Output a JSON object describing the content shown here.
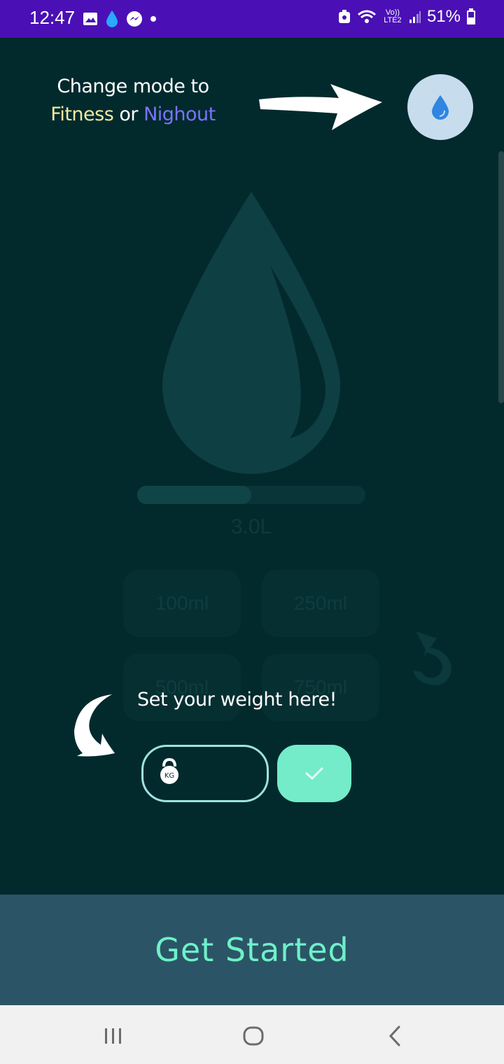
{
  "status_bar": {
    "time": "12:47",
    "network": "Vo)) LTE2",
    "battery": "51%"
  },
  "hint": {
    "line1": "Change mode to",
    "mode_fitness": "Fitness",
    "connector": "or",
    "mode_nightout": "Nighout"
  },
  "tracker": {
    "goal_label": "3.0L",
    "progress_fraction": 0.5,
    "amounts": [
      "100ml",
      "250ml",
      "500ml",
      "750ml"
    ]
  },
  "weight": {
    "label": "Set your weight here!",
    "unit_badge": "KG",
    "value": ""
  },
  "cta": {
    "label": "Get Started"
  },
  "colors": {
    "status_bar": "#4a10b5",
    "background": "#022a2d",
    "accent": "#74ecc9",
    "cta_bar": "#2b5566",
    "fitness": "#f2e8a0",
    "nightout": "#7b73ff"
  },
  "icons": {
    "mode": "water-drop-icon",
    "confirm": "check-icon",
    "undo": "undo-icon",
    "weight": "kettlebell-icon"
  }
}
